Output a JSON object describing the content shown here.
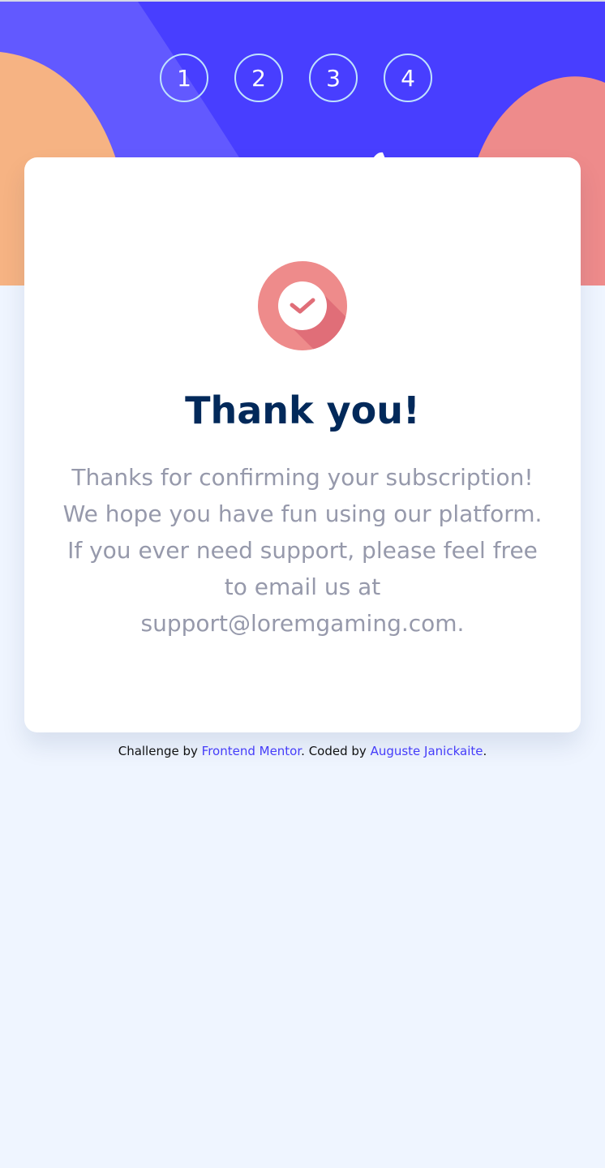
{
  "colors": {
    "hero_bg": "#483eff",
    "card_bg": "#ffffff",
    "page_bg": "#eff5ff",
    "title": "#02295a",
    "message": "#9699ab",
    "accent": "#483eff",
    "blob_orange": "#f6b383",
    "blob_pink": "#ee8b8b",
    "icon_pink": "#ee8b8b",
    "icon_shadow": "#e06e78"
  },
  "steps": [
    {
      "number": "1"
    },
    {
      "number": "2"
    },
    {
      "number": "3"
    },
    {
      "number": "4"
    }
  ],
  "icons": {
    "success": "check-circle-icon"
  },
  "card": {
    "title": "Thank you!",
    "message": "Thanks for confirming your subscription! We hope you have fun using our platform. If you ever need support, please feel free to email us at support@loremgaming.com."
  },
  "attribution": {
    "challenge_prefix": "Challenge by ",
    "challenge_link": "Frontend Mentor",
    "coded_prefix": ". Coded by ",
    "author_link": "Auguste Janickaite",
    "suffix": "."
  }
}
